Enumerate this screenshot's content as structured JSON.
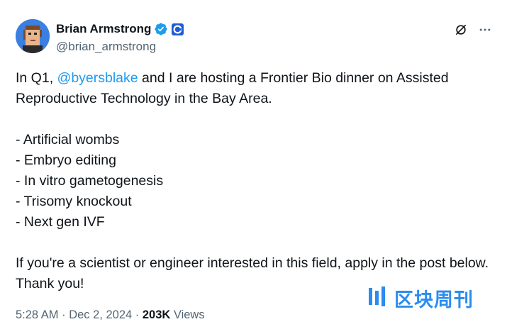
{
  "author": {
    "display_name": "Brian Armstrong",
    "handle": "@brian_armstrong",
    "verified_badge": "verified-badge-icon",
    "org_badge": "coinbase-icon"
  },
  "post": {
    "intro_before": "In Q1, ",
    "mention": "@byersblake",
    "intro_after": " and I are hosting a Frontier Bio dinner on Assisted Reproductive Technology in the Bay Area.",
    "list": [
      "- Artificial wombs",
      "- Embryo editing",
      "- In vitro gametogenesis",
      "- Trisomy knockout",
      "- Next gen IVF"
    ],
    "closing": "If you're a scientist or engineer interested in this field, apply in the post below. Thank you!"
  },
  "meta": {
    "timestamp": "5:28 AM · Dec 2, 2024 · ",
    "views_count": "203K",
    "views_label": " Views"
  },
  "watermark": {
    "text": "区块周刊"
  },
  "colors": {
    "mention": "#1d9bf0",
    "verified": "#1d9bf0",
    "org_badge": "#1f5cd6",
    "watermark": "#2b8cf0"
  }
}
